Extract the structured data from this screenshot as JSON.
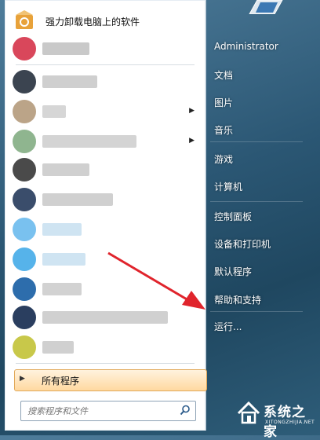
{
  "start_menu": {
    "pinned_first": {
      "label": "强力卸载电脑上的软件",
      "icon": "recycle-box-icon"
    },
    "programs": [
      {
        "icon_color": "#d9475b",
        "blur_color": "#c9c9c9",
        "blur_width": 60,
        "arrow": false
      },
      {
        "icon_color": "#3b4450",
        "blur_color": "#cfcfcf",
        "blur_width": 70,
        "arrow": false
      },
      {
        "icon_color": "#bba488",
        "blur_color": "#d6d6d6",
        "blur_width": 30,
        "arrow": true
      },
      {
        "icon_color": "#8fb58f",
        "blur_color": "#d4d4d4",
        "blur_width": 120,
        "arrow": true
      },
      {
        "icon_color": "#4a4a4a",
        "blur_color": "#d0d0d0",
        "blur_width": 60,
        "arrow": false
      },
      {
        "icon_color": "#3a4d6b",
        "blur_color": "#d0d0d0",
        "blur_width": 90,
        "arrow": false
      },
      {
        "icon_color": "#79c1ef",
        "blur_color": "#cfe4f2",
        "blur_width": 50,
        "arrow": false
      },
      {
        "icon_color": "#56b3ea",
        "blur_color": "#cfe4f2",
        "blur_width": 55,
        "arrow": false
      },
      {
        "icon_color": "#2d6dac",
        "blur_color": "#d2d2d2",
        "blur_width": 50,
        "arrow": false
      },
      {
        "icon_color": "#2a3e5f",
        "blur_color": "#d0d0d0",
        "blur_width": 160,
        "arrow": false
      },
      {
        "icon_color": "#c8c84a",
        "blur_color": "#d0d0d0",
        "blur_width": 40,
        "arrow": false
      }
    ],
    "all_programs_label": "所有程序",
    "search_placeholder": "搜索程序和文件"
  },
  "right_panel": {
    "items": [
      "Administrator",
      "文档",
      "图片",
      "音乐",
      "游戏",
      "计算机",
      "控制面板",
      "设备和打印机",
      "默认程序",
      "帮助和支持",
      "运行..."
    ]
  },
  "watermark": {
    "main": "系统之家",
    "sub": "XITONGZHIJIA.NET",
    "icon": "house-logo-icon"
  },
  "colors": {
    "arrow": "#e0242c",
    "accent_orange": "#ffd9a0"
  }
}
